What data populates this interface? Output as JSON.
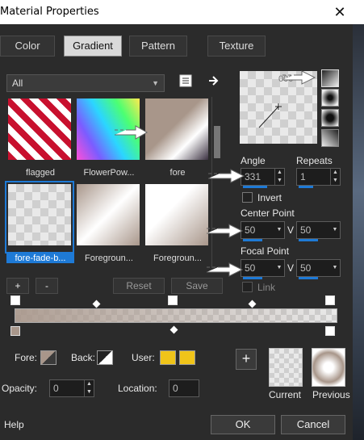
{
  "window": {
    "title": "Material Properties",
    "close_glyph": "✕"
  },
  "tabs": [
    {
      "label": "Color"
    },
    {
      "label": "Gradient"
    },
    {
      "label": "Pattern"
    },
    {
      "label": "Texture"
    }
  ],
  "filter": {
    "selected": "All"
  },
  "gradients": [
    {
      "label": "flagged"
    },
    {
      "label": "FlowerPow..."
    },
    {
      "label": "fore"
    },
    {
      "label": "fore-fade-b..."
    },
    {
      "label": "Foregroun..."
    },
    {
      "label": "Foregroun..."
    }
  ],
  "buttons": {
    "add": "+",
    "remove": "-",
    "reset": "Reset",
    "save": "Save"
  },
  "angle": {
    "label": "Angle",
    "value": "331"
  },
  "repeats": {
    "label": "Repeats",
    "value": "1"
  },
  "invert": {
    "label": "Invert",
    "checked": false
  },
  "center_point": {
    "label": "Center Point",
    "h": "50",
    "v_label": "V",
    "v": "50"
  },
  "focal_point": {
    "label": "Focal Point",
    "h": "50",
    "v_label": "V",
    "v": "50"
  },
  "link": {
    "label": "Link"
  },
  "preview_text": "000",
  "properties": {
    "fore_label": "Fore:",
    "back_label": "Back:",
    "user_label": "User:",
    "opacity_label": "Opacity:",
    "opacity_value": "0",
    "location_label": "Location:",
    "location_value": "0"
  },
  "swatches": {
    "current_label": "Current",
    "previous_label": "Previous",
    "user_color": "#f0c419"
  },
  "footer": {
    "help": "Help",
    "ok": "OK",
    "cancel": "Cancel"
  },
  "colors": {
    "accent": "#1e7ad6",
    "background": "#2b2b2b",
    "gradient_fore": "#a8968a"
  }
}
